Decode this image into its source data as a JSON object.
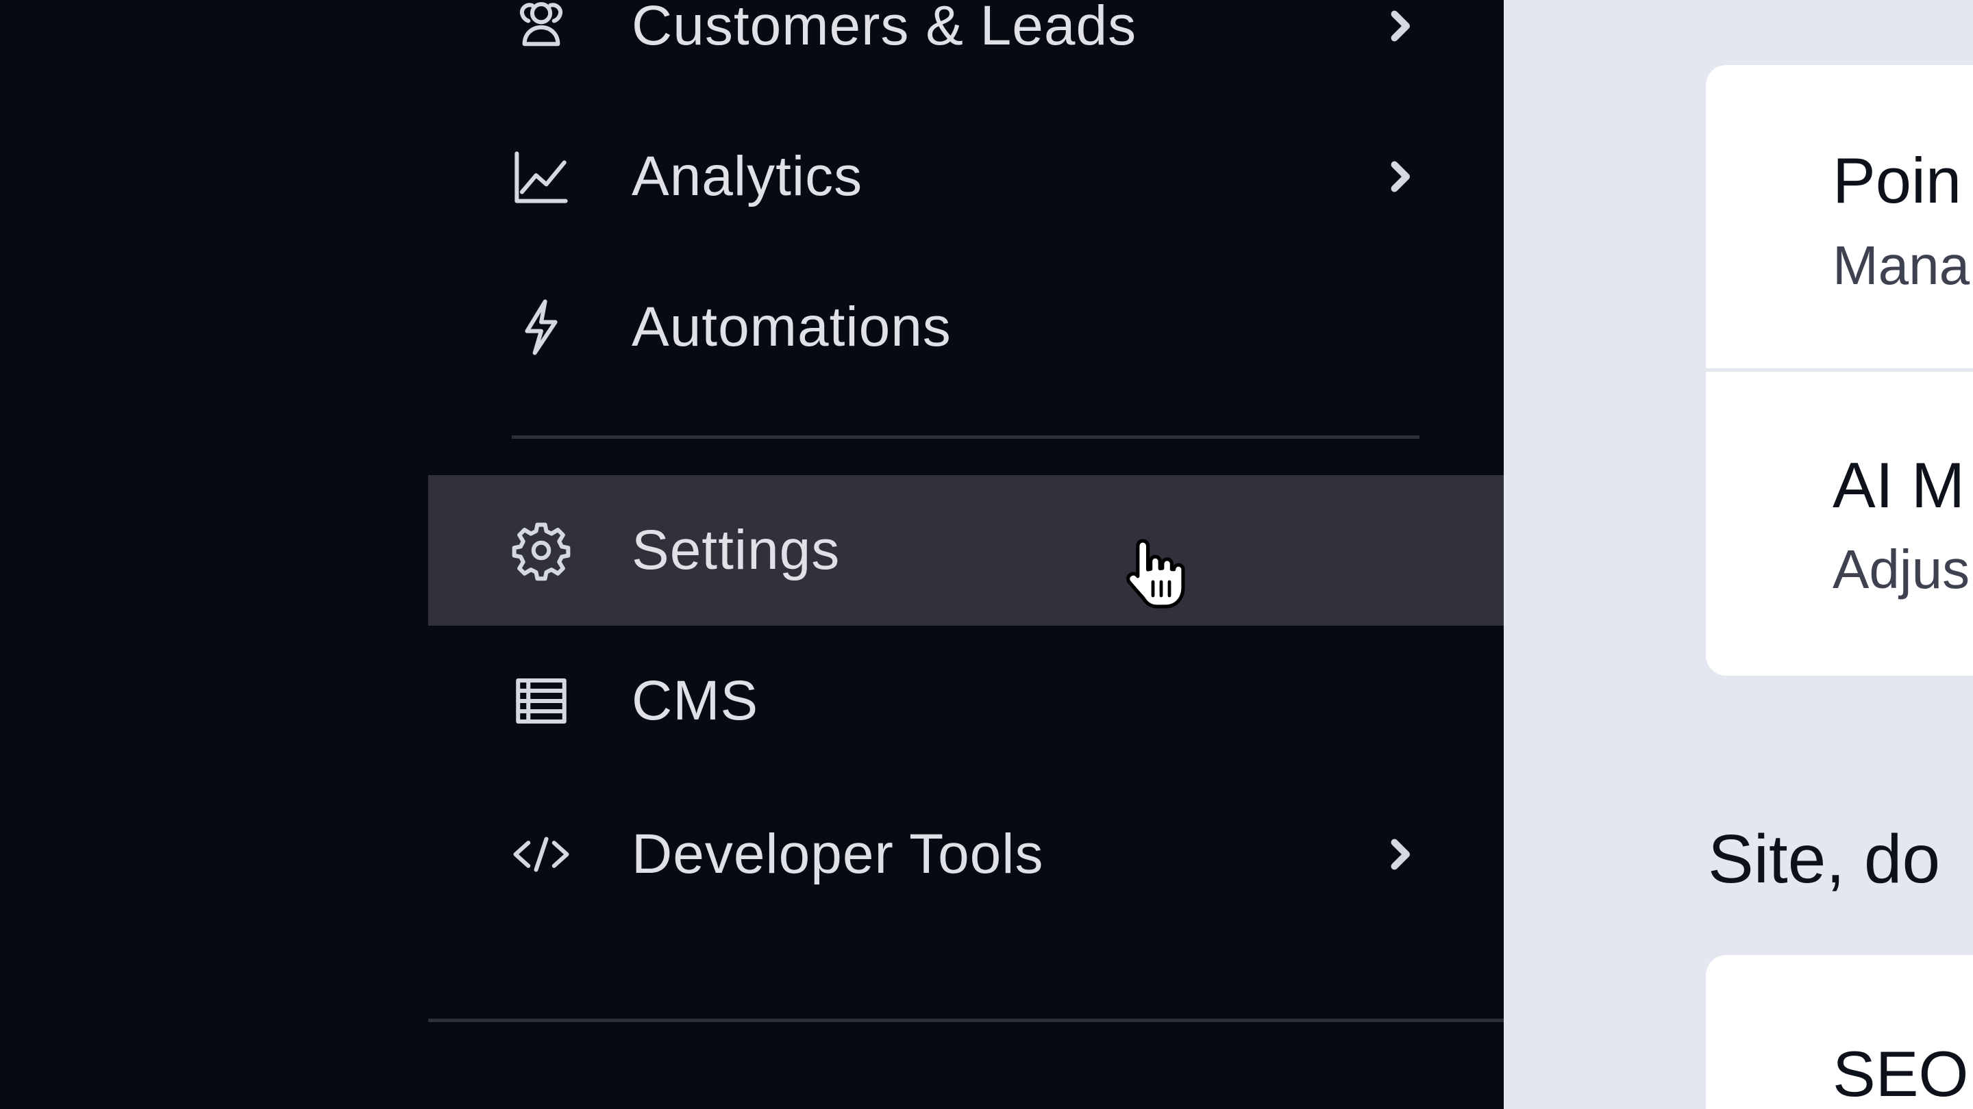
{
  "sidebar": {
    "items": [
      {
        "label": "Customers & Leads",
        "icon": "customers-icon",
        "has_submenu": true
      },
      {
        "label": "Analytics",
        "icon": "analytics-chart-icon",
        "has_submenu": true
      },
      {
        "label": "Automations",
        "icon": "lightning-bolt-icon",
        "has_submenu": false
      },
      {
        "label": "Settings",
        "icon": "gear-icon",
        "has_submenu": false,
        "active": true
      },
      {
        "label": "CMS",
        "icon": "table-icon",
        "has_submenu": false
      },
      {
        "label": "Developer Tools",
        "icon": "code-icon",
        "has_submenu": true
      }
    ]
  },
  "main": {
    "cards": [
      {
        "title": "Poin",
        "subtitle": "Mana"
      },
      {
        "title": "AI M",
        "subtitle": "Adjus"
      }
    ],
    "section_heading": "Site, do",
    "second_card_title": "SEO"
  },
  "colors": {
    "sidebar_bg": "#070a13",
    "active_item_bg": "#30313b",
    "sidebar_text": "#dfe1e7",
    "main_bg": "#e4e7f0",
    "card_bg": "#ffffff"
  }
}
